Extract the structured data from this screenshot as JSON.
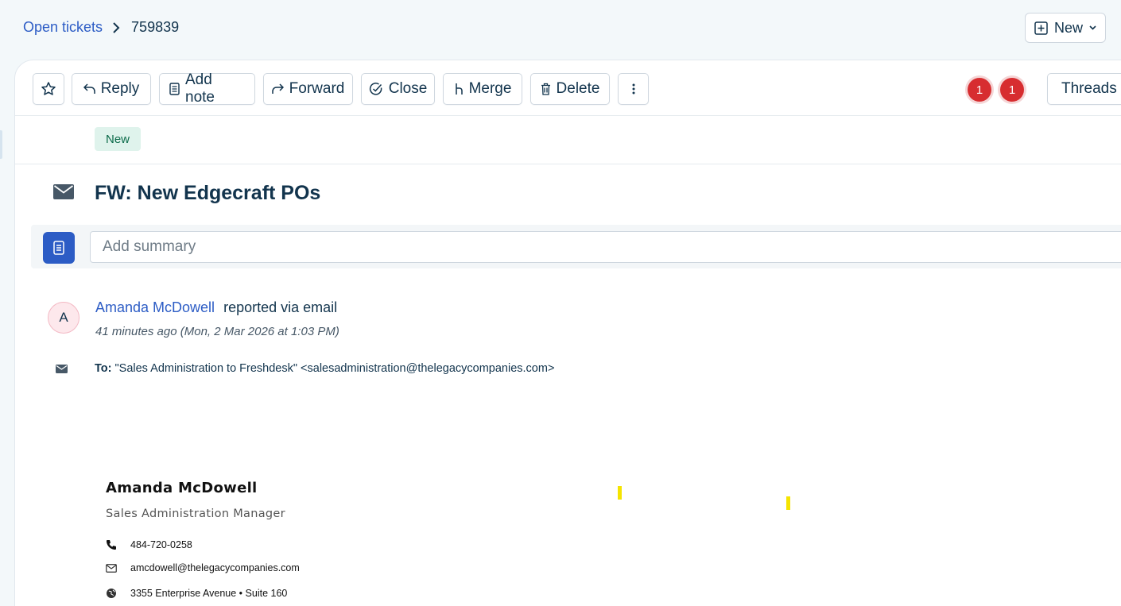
{
  "breadcrumb": {
    "parent": "Open tickets",
    "ticket_id": "759839"
  },
  "header": {
    "new_button_label": "New"
  },
  "toolbar": {
    "reply": "Reply",
    "add_note": "Add note",
    "forward": "Forward",
    "close": "Close",
    "merge": "Merge",
    "delete": "Delete",
    "notification_counts": [
      "1",
      "1"
    ],
    "threads": "Threads"
  },
  "ticket": {
    "status": "New",
    "subject": "FW: New Edgecraft POs",
    "summary_placeholder": "Add summary"
  },
  "message": {
    "avatar_initial": "A",
    "requester_name": "Amanda McDowell",
    "reported_via": "reported via email",
    "timestamp": "41 minutes ago (Mon, 2 Mar 2026 at 1:03 PM)",
    "to_label": "To:",
    "to_value": "\"Sales Administration to Freshdesk\" <salesadministration@thelegacycompanies.com>"
  },
  "signature": {
    "name": "Amanda McDowell",
    "title": "Sales Administration Manager",
    "phone": "484-720-0258",
    "email": "amcdowell@thelegacycompanies.com",
    "address": "3355 Enterprise Avenue • Suite 160"
  },
  "colors": {
    "accent": "#2c5cc5",
    "badge_red": "#d72d30",
    "status_green_bg": "#dff3ec"
  }
}
